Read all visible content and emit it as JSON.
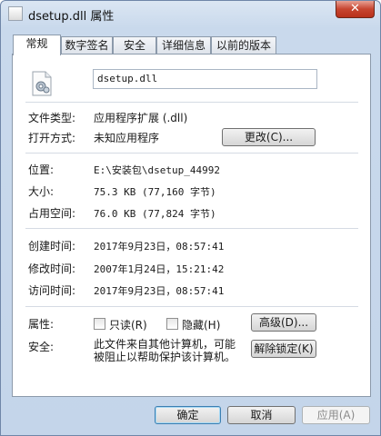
{
  "window": {
    "title": "dsetup.dll 属性",
    "close_glyph": "✕"
  },
  "tabs": [
    {
      "label": "常规",
      "active": true
    },
    {
      "label": "数字签名"
    },
    {
      "label": "安全"
    },
    {
      "label": "详细信息"
    },
    {
      "label": "以前的版本"
    }
  ],
  "general": {
    "file_name": "dsetup.dll",
    "file_type_label": "文件类型:",
    "file_type_value": "应用程序扩展 (.dll)",
    "open_with_label": "打开方式:",
    "open_with_value": "未知应用程序",
    "change_button": "更改(C)...",
    "location_label": "位置:",
    "location_value": "E:\\安装包\\dsetup_44992",
    "size_label": "大小:",
    "size_value": "75.3 KB (77,160 字节)",
    "size_on_disk_label": "占用空间:",
    "size_on_disk_value": "76.0 KB (77,824 字节)",
    "created_label": "创建时间:",
    "created_value": "2017年9月23日，08:57:41",
    "modified_label": "修改时间:",
    "modified_value": "2007年1月24日，15:21:42",
    "accessed_label": "访问时间:",
    "accessed_value": "2017年9月23日，08:57:41",
    "attributes_label": "属性:",
    "readonly_label": "只读(R)",
    "hidden_label": "隐藏(H)",
    "advanced_button": "高级(D)...",
    "security_label": "安全:",
    "security_text": "此文件来自其他计算机，可能被阻止以帮助保护该计算机。",
    "unblock_button": "解除锁定(K)"
  },
  "footer": {
    "ok_button": "确定",
    "cancel_button": "取消",
    "apply_button": "应用(A)"
  }
}
